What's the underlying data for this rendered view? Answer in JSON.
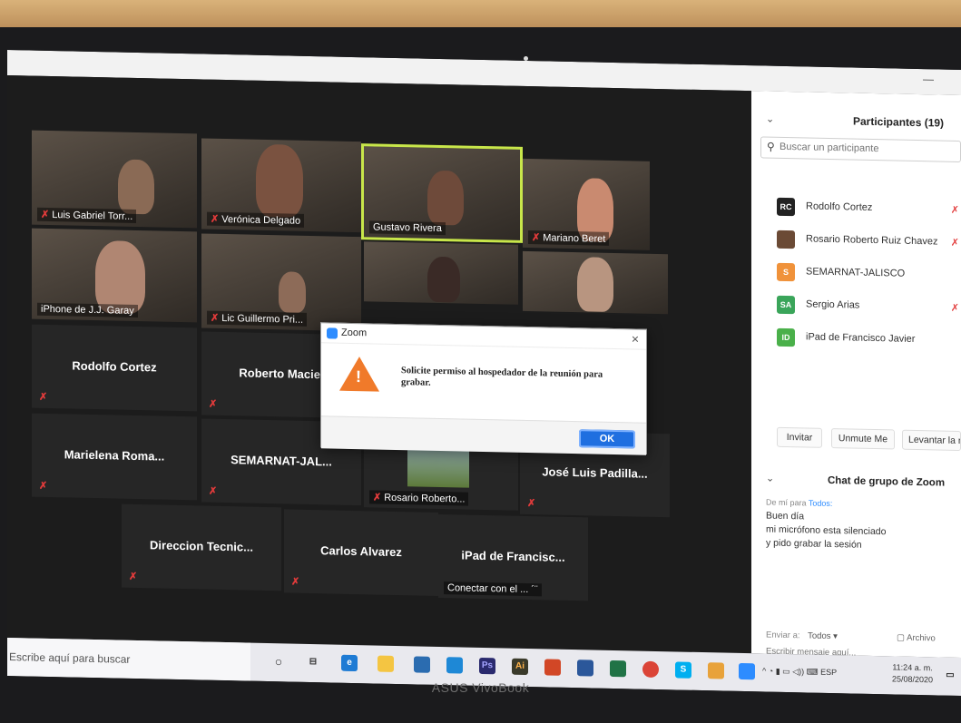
{
  "device": {
    "brand": "ASUS VivoBook"
  },
  "gallery": {
    "tiles": [
      {
        "name": "Luis Gabriel Torr..."
      },
      {
        "name": "Verónica Delgado"
      },
      {
        "name": "Gustavo Rivera"
      },
      {
        "name": "Mariano Beret"
      },
      {
        "name": "iPhone de J.J. Garay"
      },
      {
        "name": "Lic Guillermo Pri..."
      },
      {
        "name": "Rodolfo Cortez"
      },
      {
        "name": "Roberto Maciel"
      },
      {
        "name": "Marielena Roma..."
      },
      {
        "name": "SEMARNAT-JAL..."
      },
      {
        "name": "Rosario Roberto..."
      },
      {
        "name": "José Luis Padilla..."
      },
      {
        "name": "Direccion Tecnic..."
      },
      {
        "name": "Carlos Alvarez"
      },
      {
        "name": "iPad de Francisc...",
        "status": "Conectar con el ... ´¨"
      }
    ]
  },
  "dialog": {
    "title": "Zoom",
    "close": "×",
    "message": "Solicite permiso al hospedador de la reunión para grabar.",
    "ok_label": "OK"
  },
  "panel": {
    "title": "Participantes (19)",
    "search_placeholder": "Buscar un participante",
    "participants": [
      {
        "initials": "RC",
        "name": "Rodolfo Cortez",
        "color": "#222222"
      },
      {
        "initials": "",
        "name": "Rosario Roberto Ruiz Chavez",
        "color": "#6b4a35"
      },
      {
        "initials": "S",
        "name": "SEMARNAT-JALISCO",
        "color": "#f0923a"
      },
      {
        "initials": "SA",
        "name": "Sergio Arias",
        "color": "#3aa55a"
      },
      {
        "initials": "ID",
        "name": "iPad de Francisco Javier",
        "color": "#4ab04a"
      }
    ],
    "buttons": {
      "invite": "Invitar",
      "unmute": "Unmute Me",
      "raise_hand": "Levantar la ma"
    }
  },
  "chat": {
    "title": "Chat de grupo de Zoom",
    "meta_prefix": "De mí para",
    "meta_to": "Todos:",
    "messages": [
      "Buen día",
      "mi micrófono esta silenciado",
      "y pido grabar la sesión"
    ],
    "send_to_label": "Enviar a:",
    "send_to_value": "Todos ▾",
    "file_label": "Archivo",
    "input_placeholder": "Escribir mensaje aquí..."
  },
  "taskbar": {
    "search_placeholder": "Escribe aquí para buscar",
    "language": "ESP",
    "time": "11:24 a. m.",
    "date": "25/08/2020"
  }
}
